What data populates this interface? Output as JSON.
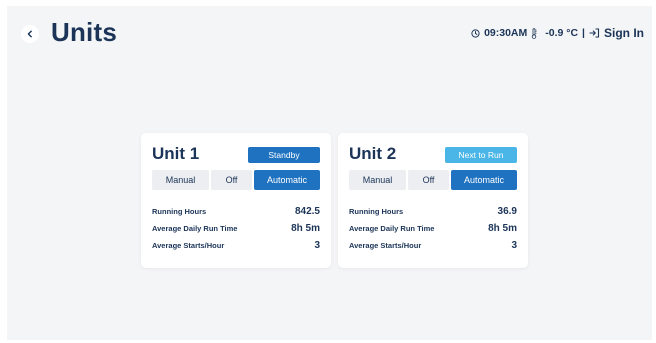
{
  "header": {
    "title": "Units",
    "time": "09:30AM",
    "temperature": "-0.9 °C",
    "separator": "|",
    "sign_in": "Sign In"
  },
  "icons": {
    "back": "chevron-left-icon",
    "clock": "clock-icon",
    "thermometer": "thermometer-icon",
    "sign_in": "sign-in-icon"
  },
  "colors": {
    "title": "#1b3457",
    "standby": "#1f72c0",
    "next_to_run": "#4ab6e8",
    "active_mode": "#1f72c0",
    "inactive_mode": "#eceef1",
    "background": "#f4f5f7"
  },
  "units": [
    {
      "name": "Unit 1",
      "state": "Standby",
      "modes": [
        "Manual",
        "Off",
        "Automatic"
      ],
      "active_mode": "Automatic",
      "stats": [
        {
          "label": "Running Hours",
          "value": "842.5"
        },
        {
          "label": "Average Daily Run Time",
          "value": "8h 5m"
        },
        {
          "label": "Average Starts/Hour",
          "value": "3"
        }
      ]
    },
    {
      "name": "Unit 2",
      "state": "Next to Run",
      "modes": [
        "Manual",
        "Off",
        "Automatic"
      ],
      "active_mode": "Automatic",
      "stats": [
        {
          "label": "Running Hours",
          "value": "36.9"
        },
        {
          "label": "Average Daily Run Time",
          "value": "8h 5m"
        },
        {
          "label": "Average Starts/Hour",
          "value": "3"
        }
      ]
    }
  ]
}
